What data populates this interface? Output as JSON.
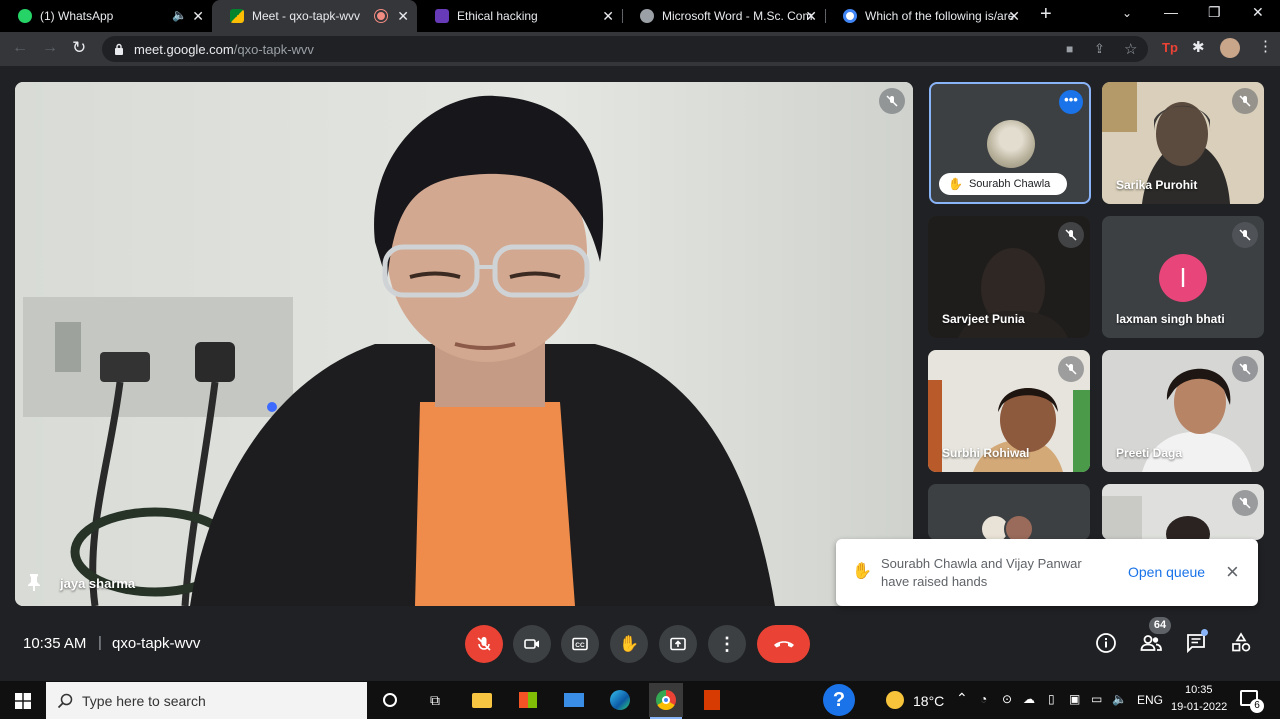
{
  "browser": {
    "tabs": [
      {
        "title": "(1) WhatsApp",
        "favicon_color": "#25d366"
      },
      {
        "title": "Meet - qxo-tapk-wvv",
        "favicon_color": "#00832d"
      },
      {
        "title": "Ethical hacking",
        "favicon_color": "#673ab7"
      },
      {
        "title": "Microsoft Word - M.Sc. Com",
        "favicon_color": "#9aa0a6"
      },
      {
        "title": "Which of the following is/are",
        "favicon_color": "#4285f4"
      }
    ],
    "new_tab_label": "+",
    "url_host": "meet.google.com",
    "url_path": "/qxo-tapk-wvv",
    "extension_label": "Tp"
  },
  "meet": {
    "main_speaker": "jaya sharma",
    "participants": [
      {
        "name": "Sourabh Chawla",
        "hand_raised": true
      },
      {
        "name": "Sarika Purohit"
      },
      {
        "name": "Sarvjeet Punia"
      },
      {
        "name": "laxman singh bhati",
        "avatar_letter": "l",
        "avatar_color": "#e8457a"
      },
      {
        "name": "Surbhi Rohiwal"
      },
      {
        "name": "Preeti Daga"
      }
    ],
    "toast": {
      "message": "Sourabh Chawla and Vijay Panwar have raised hands",
      "action": "Open queue"
    },
    "time": "10:35 AM",
    "separator": "|",
    "meeting_code": "qxo-tapk-wvv",
    "participant_count": "64",
    "colors": {
      "end_call": "#ea4335",
      "accent": "#8ab4f8"
    }
  },
  "taskbar": {
    "search_placeholder": "Type here to search",
    "weather": "18°C",
    "language": "ENG",
    "clock_time": "10:35",
    "clock_date": "19-01-2022",
    "notification_count": "6"
  }
}
